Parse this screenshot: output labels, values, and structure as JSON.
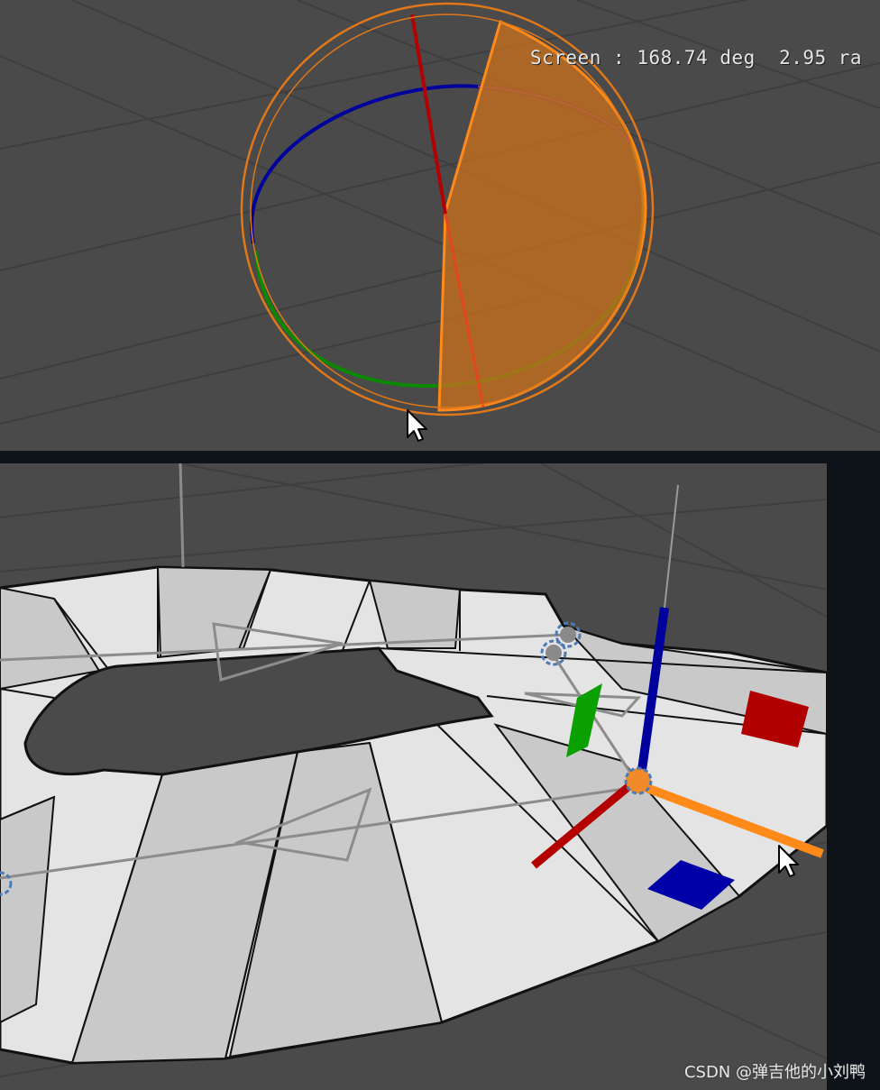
{
  "rotate_readout": {
    "label": "Screen",
    "separator": ":",
    "degrees": "168.74 deg",
    "radians": "2.95 ra"
  },
  "colors": {
    "viewport_bg": "#4a4a4a",
    "x_axis": "#b40000",
    "y_axis": "#0a8a00",
    "z_axis": "#00009c",
    "screen_ring": "#e0781a",
    "rotation_arc_fill": "#c8701e",
    "mesh_light": "#e6e6e6",
    "mesh_dark": "#c9c9c9"
  },
  "icons": {
    "rotate_cursor": "arrow-cursor-icon",
    "move_cursor": "arrow-cursor-icon"
  },
  "watermark": "CSDN @弹吉他的小刘鸭"
}
